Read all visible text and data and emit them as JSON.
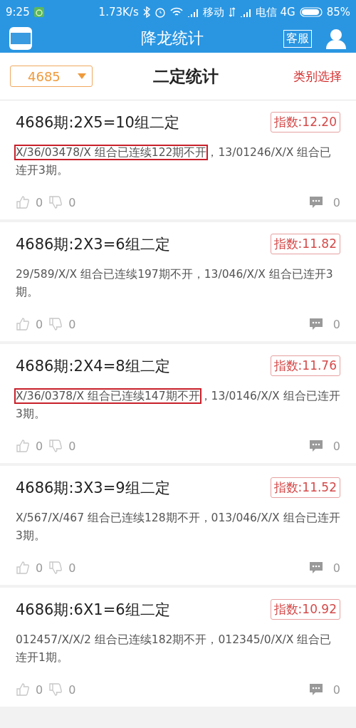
{
  "status_bar": {
    "time": "9:25",
    "speed": "1.73K/s",
    "carrier_1": "移动",
    "carrier_2": "电信 4G",
    "battery": "85%"
  },
  "header": {
    "title": "降龙统计",
    "service": "客服"
  },
  "toolbar": {
    "period": "4685",
    "title": "二定统计",
    "category": "类别选择"
  },
  "cards": [
    {
      "title": "4686期:2X5=10组二定",
      "index": "指数:12.20",
      "description": [
        {
          "text": "X/36/03478/X 组合已连续122期不开",
          "boxed": true
        },
        {
          "text": "，13/01246/X/X 组合已连开3期。",
          "boxed": false
        }
      ],
      "likes": "0",
      "dislikes": "0",
      "comments": "0"
    },
    {
      "title": "4686期:2X3=6组二定",
      "index": "指数:11.82",
      "description": [
        {
          "text": "29/589/X/X 组合已连续197期不开，13/046/X/X 组合已连开3期。",
          "boxed": false
        }
      ],
      "likes": "0",
      "dislikes": "0",
      "comments": "0"
    },
    {
      "title": "4686期:2X4=8组二定",
      "index": "指数:11.76",
      "description": [
        {
          "text": "X/36/0378/X 组合已连续147期不开",
          "boxed": true
        },
        {
          "text": "，13/0146/X/X 组合已连开3期。",
          "boxed": false
        }
      ],
      "likes": "0",
      "dislikes": "0",
      "comments": "0"
    },
    {
      "title": "4686期:3X3=9组二定",
      "index": "指数:11.52",
      "description": [
        {
          "text": "X/567/X/467 组合已连续128期不开，013/046/X/X 组合已连开3期。",
          "boxed": false
        }
      ],
      "likes": "0",
      "dislikes": "0",
      "comments": "0"
    },
    {
      "title": "4686期:6X1=6组二定",
      "index": "指数:10.92",
      "description": [
        {
          "text": "012457/X/X/2 组合已连续182期不开，012345/0/X/X 组合已连开1期。",
          "boxed": false
        }
      ],
      "likes": "0",
      "dislikes": "0",
      "comments": "0"
    }
  ]
}
